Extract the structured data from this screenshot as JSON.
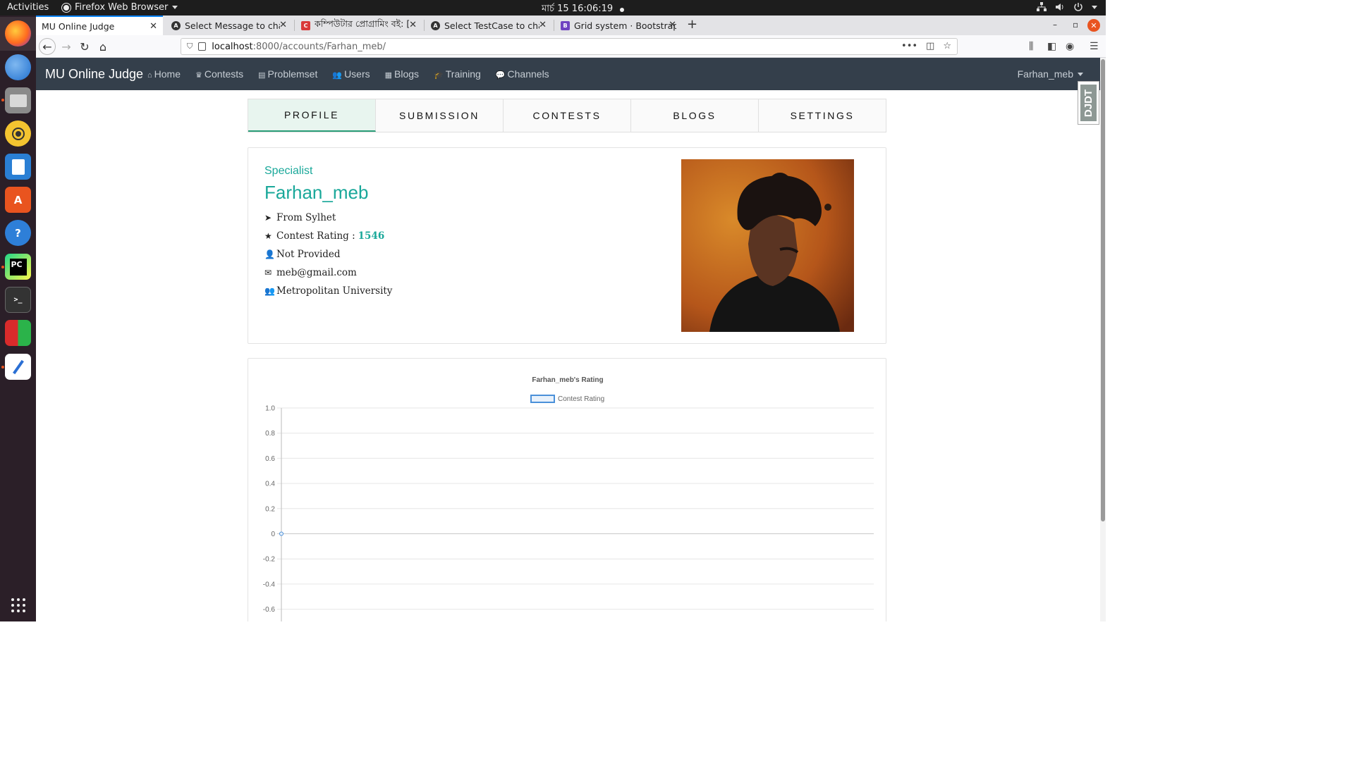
{
  "desktop": {
    "activities": "Activities",
    "app_menu": "Firefox Web Browser",
    "clock": "মার্চ 15  16:06:19"
  },
  "browser": {
    "tabs": [
      {
        "title": "MU Online Judge",
        "favicon": "globe"
      },
      {
        "title": "Select Message to chang",
        "favicon": "django-admin"
      },
      {
        "title": "কম্পিউটার প্রোগ্রামিং বই: [প্রো",
        "favicon": "c-site"
      },
      {
        "title": "Select TestCase to chang",
        "favicon": "django-admin"
      },
      {
        "title": "Grid system · Bootstrap",
        "favicon": "bootstrap"
      }
    ],
    "url_host": "localhost",
    "url_path": ":8000/accounts/Farhan_meb/"
  },
  "site": {
    "brand": "MU Online Judge",
    "nav": [
      {
        "label": "Home",
        "icon": "home-icon"
      },
      {
        "label": "Contests",
        "icon": "trophy-icon"
      },
      {
        "label": "Problemset",
        "icon": "list-icon"
      },
      {
        "label": "Users",
        "icon": "users-icon"
      },
      {
        "label": "Blogs",
        "icon": "newspaper-icon"
      },
      {
        "label": "Training",
        "icon": "graduation-cap-icon"
      },
      {
        "label": "Channels",
        "icon": "comments-icon"
      }
    ],
    "user_menu": "Farhan_meb",
    "debug_toolbar": "DJDT"
  },
  "profile_tabs": [
    "PROFILE",
    "SUBMISSION",
    "CONTESTS",
    "BLOGS",
    "SETTINGS"
  ],
  "profile": {
    "rank": "Specialist",
    "username": "Farhan_meb",
    "location": "From Sylhet",
    "rating_label": "Contest Rating :",
    "rating_value": "1546",
    "gender": "Not Provided",
    "email": "meb@gmail.com",
    "institution": "Metropolitan University"
  },
  "colors": {
    "accent": "#1aa89a",
    "navbar": "#343f4b",
    "line_series": "#4a90d9"
  },
  "chart_data": {
    "type": "line",
    "title": "Farhan_meb's Rating",
    "legend": [
      "Contest Rating"
    ],
    "legend_position": "top",
    "grid": true,
    "series": [
      {
        "name": "Contest Rating",
        "values": [
          0
        ]
      }
    ],
    "x": [
      ""
    ],
    "yticks": [
      "1.0",
      "0.8",
      "0.6",
      "0.4",
      "0.2",
      "0",
      "-0.2",
      "-0.4",
      "-0.6"
    ],
    "ylim": [
      -0.6,
      1.0
    ]
  }
}
